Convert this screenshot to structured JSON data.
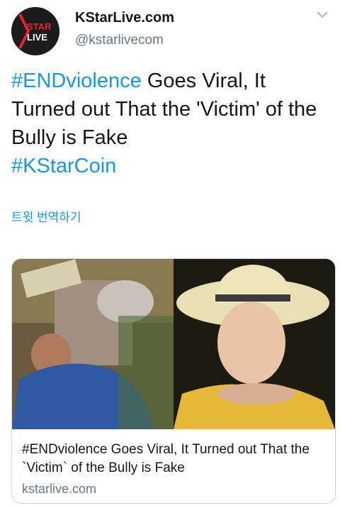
{
  "author": {
    "display_name": "KStarLive.com",
    "handle": "@kstarlivecom",
    "avatar_logo_text": [
      "STAR",
      "LIVE"
    ]
  },
  "tweet": {
    "hashtag1": "#ENDviolence",
    "body": " Goes Viral, It Turned out That the 'Victim' of the Bully is Fake",
    "hashtag2": "#KStarCoin"
  },
  "translate_label": "트윗 번역하기",
  "card": {
    "title": "#ENDviolence Goes Viral, It Turned out That the `Victim` of the Bully is Fake",
    "domain": "kstarlive.com"
  },
  "colors": {
    "link": "#1b95e0",
    "text": "#14171a",
    "secondary": "#657786",
    "border": "#ccd6dd"
  },
  "icons": {
    "menu": "chevron-down-icon"
  }
}
